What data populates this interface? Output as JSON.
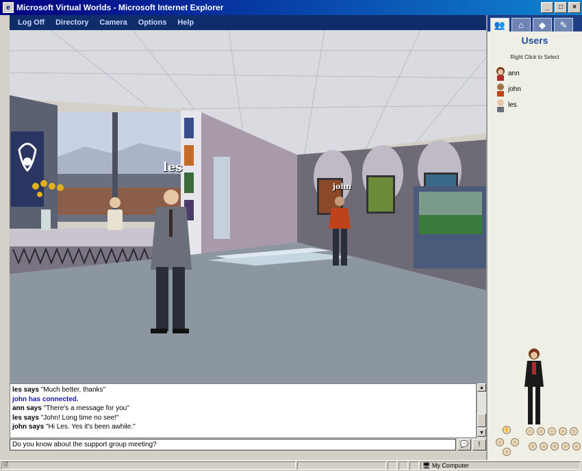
{
  "window": {
    "title": "Microsoft Virtual Worlds - Microsoft Internet Explorer",
    "controls": [
      "_",
      "□",
      "×"
    ]
  },
  "menu": [
    "Log Off",
    "Directory",
    "Camera",
    "Options",
    "Help"
  ],
  "scene": {
    "name_tags": {
      "les": "les",
      "john": "john"
    }
  },
  "chat": {
    "lines": [
      {
        "who": "les says",
        "text": " \"Much better, thanks\""
      },
      {
        "who": "john has connected.",
        "text": ""
      },
      {
        "who": "ann says",
        "text": " \"There's a message for you\""
      },
      {
        "who": "les says",
        "text": " \"John! Long time no see!\""
      },
      {
        "who": "john says",
        "text": " \"Hi Les.  Yes it's been awhile.\""
      }
    ],
    "input_value": "Do you know about the support group meeting?"
  },
  "panel": {
    "tabs": [
      "users-icon",
      "house-icon",
      "object-icon",
      "tools-icon"
    ],
    "title": "Users",
    "hint": "Right Click to Select",
    "users": [
      "ann",
      "john",
      "les"
    ]
  },
  "statusbar": {
    "zone": "My Computer"
  },
  "colors": {
    "titlebar": "#000080",
    "menubar": "#0f2d6b",
    "panel_title": "#1e4b9b",
    "system_message": "#1a1ab0"
  }
}
